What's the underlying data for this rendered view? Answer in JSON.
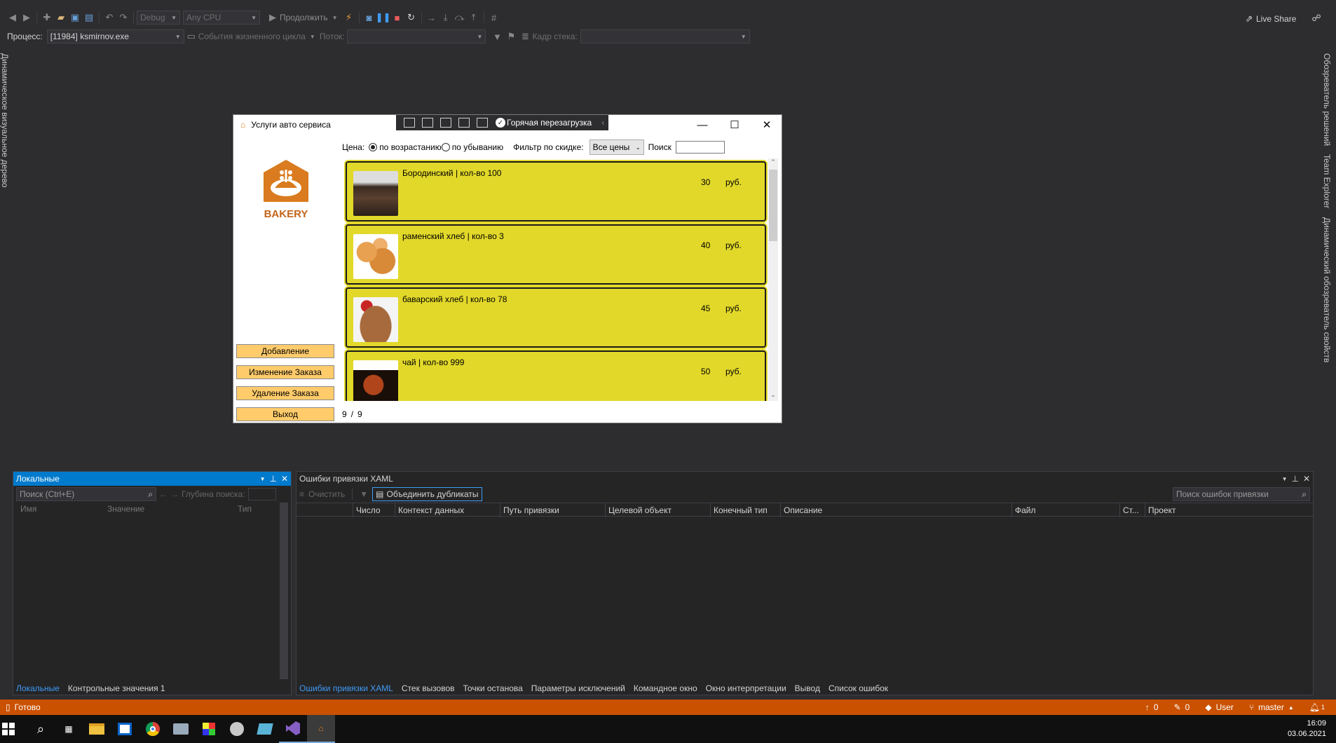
{
  "toolbar": {
    "config": "Debug",
    "platform": "Any CPU",
    "continue": "Продолжить",
    "live_share": "Live Share"
  },
  "debug_bar": {
    "process_label": "Процесс:",
    "process_value": "[11984] ksmirnov.exe",
    "lifecycle_events": "События жизненного цикла",
    "thread_label": "Поток:",
    "stack_frame_label": "Кадр стека:"
  },
  "left_rail": {
    "label": "Динамическое визуальное дерево"
  },
  "right_rail": {
    "items": [
      "Обозреватель решений",
      "Team Explorer",
      "Динамический обозреватель свойств"
    ]
  },
  "app": {
    "title": "Услуги авто сервиса",
    "hot_reload": "Горячая перезагрузка",
    "logo_text": "BAKERY",
    "price_label": "Цена:",
    "sort_asc": "по возрастанию",
    "sort_desc": "по убыванию",
    "discount_filter_label": "Фильтр по скидке:",
    "discount_filter_value": "Все цены",
    "search_label": "Поиск",
    "buttons": {
      "add": "Добавление",
      "edit": "Изменение Заказа",
      "delete": "Удаление Заказа",
      "exit": "Выход"
    },
    "paging": {
      "current": "9",
      "sep": "/",
      "total": "9"
    },
    "products": [
      {
        "name": "Бородинский  | кол-во 100",
        "price": "30",
        "currency": "руб.",
        "image": "dark-bread"
      },
      {
        "name": "раменский хлеб | кол-во 3",
        "price": "40",
        "currency": "руб.",
        "image": "round-buns"
      },
      {
        "name": "баварский хлеб | кол-во 78",
        "price": "45",
        "currency": "руб.",
        "image": "sliced-loaf"
      },
      {
        "name": "чай  | кол-во 999",
        "price": "50",
        "currency": "руб.",
        "image": "tea-cup"
      }
    ]
  },
  "locals_panel": {
    "title": "Локальные",
    "search_placeholder": "Поиск (Ctrl+E)",
    "depth_label": "Глубина поиска:",
    "columns": [
      "Имя",
      "Значение",
      "Тип"
    ],
    "tabs": [
      "Локальные",
      "Контрольные значения 1"
    ]
  },
  "xaml_panel": {
    "title": "Ошибки привязки XAML",
    "clear": "Очистить",
    "merge_duplicates": "Объединить дубликаты",
    "search_placeholder": "Поиск ошибок привязки",
    "columns": [
      "Число",
      "Контекст данных",
      "Путь привязки",
      "Целевой объект",
      "Конечный тип",
      "Описание",
      "Файл",
      "Ст...",
      "Проект"
    ],
    "tabs": [
      "Ошибки привязки XAML",
      "Стек вызовов",
      "Точки останова",
      "Параметры исключений",
      "Командное окно",
      "Окно интерпретации",
      "Вывод",
      "Список ошибок"
    ]
  },
  "status_bar": {
    "ready": "Готово",
    "up_count": "0",
    "edit_count": "0",
    "user": "User",
    "branch": "master",
    "notif": "1"
  },
  "taskbar": {
    "time": "16:09",
    "date": "03.06.2021"
  },
  "colors": {
    "status_bar": "#ca5100",
    "card": "#e2d82a",
    "side_button": "#ffcb6b",
    "accent_blue": "#007acc"
  }
}
